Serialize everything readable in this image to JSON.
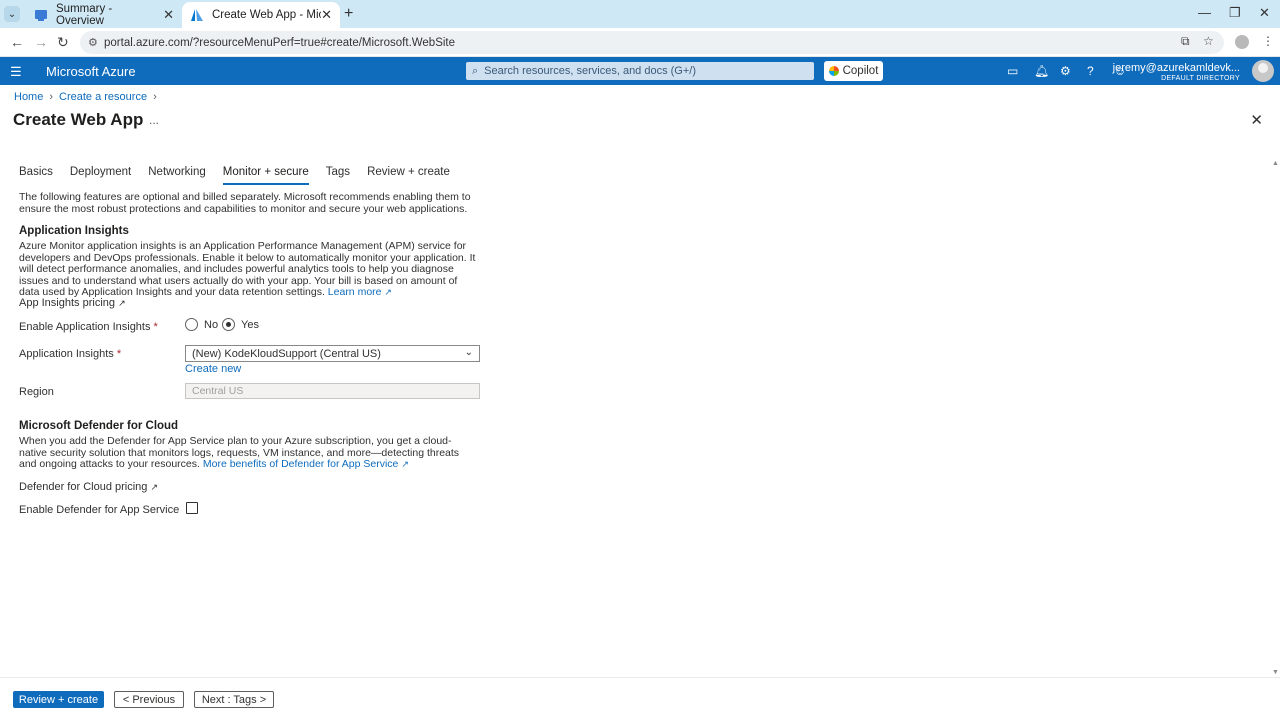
{
  "browser": {
    "tabs": [
      {
        "title": "Summary - Overview"
      },
      {
        "title": "Create Web App - Microsoft Az"
      }
    ],
    "url": "portal.azure.com/?resourceMenuPerf=true#create/Microsoft.WebSite"
  },
  "azure": {
    "brand": "Microsoft Azure",
    "search_placeholder": "Search resources, services, and docs (G+/)",
    "copilot": "Copilot",
    "user_email": "jeremy@azurekamldevk...",
    "user_directory": "DEFAULT DIRECTORY"
  },
  "breadcrumb": [
    "Home",
    "Create a resource"
  ],
  "page": {
    "title": "Create Web App",
    "more": "...",
    "tabs": [
      "Basics",
      "Deployment",
      "Networking",
      "Monitor + secure",
      "Tags",
      "Review + create"
    ],
    "active_tab": "Monitor + secure",
    "intro": "The following features are optional and billed separately. Microsoft recommends enabling them to ensure the most robust protections and capabilities to monitor and secure your web applications."
  },
  "app_insights": {
    "heading": "Application Insights",
    "description": "Azure Monitor application insights is an Application Performance Management (APM) service for developers and DevOps professionals. Enable it below to automatically monitor your application. It will detect performance anomalies, and includes powerful analytics tools to help you diagnose issues and to understand what users actually do with your app. Your bill is based on amount of data used by Application Insights and your data retention settings.",
    "learn_more": "Learn more",
    "pricing_link": "App Insights pricing",
    "enable_label": "Enable Application Insights",
    "option_no": "No",
    "option_yes": "Yes",
    "selected": "Yes",
    "ai_label": "Application Insights",
    "ai_value": "(New) KodeKloudSupport (Central US)",
    "create_new": "Create new",
    "region_label": "Region",
    "region_value": "Central US"
  },
  "defender": {
    "heading": "Microsoft Defender for Cloud",
    "description": "When you add the Defender for App Service plan to your Azure subscription, you get a cloud-native security solution that monitors logs, requests, VM instance, and more—detecting threats and ongoing attacks to your resources.",
    "more_link": "More benefits of Defender for App Service",
    "pricing_link": "Defender for Cloud pricing",
    "enable_label": "Enable Defender for App Service",
    "enabled": false
  },
  "footer": {
    "review_create": "Review + create",
    "previous": "< Previous",
    "next": "Next : Tags >"
  }
}
